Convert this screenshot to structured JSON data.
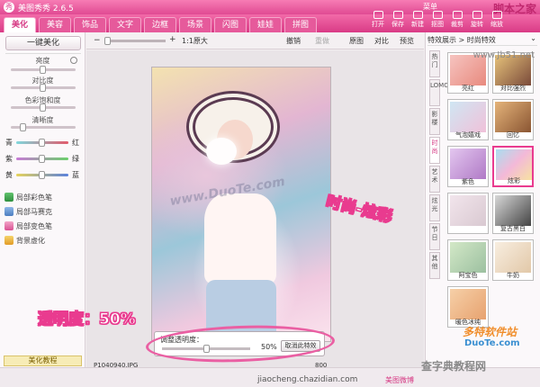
{
  "window": {
    "title": "美图秀秀 2.6.5",
    "logo": "秀"
  },
  "watermark_top": "脚本之家",
  "watermark_url": "www.Jb51.net",
  "tabs": [
    "美化",
    "美容",
    "饰品",
    "文字",
    "边框",
    "场景",
    "闪图",
    "娃娃",
    "拼图"
  ],
  "toolbar": [
    "打开",
    "保存",
    "新建",
    "抠图",
    "裁剪",
    "旋转",
    "缩放"
  ],
  "help_link": "菜单",
  "left": {
    "onekey": "一键美化",
    "sliders": [
      "亮度",
      "对比度",
      "色彩饱和度",
      "清晰度"
    ],
    "color_pairs": [
      [
        "青",
        "红"
      ],
      [
        "紫",
        "绿"
      ],
      [
        "黄",
        "蓝"
      ]
    ],
    "options": [
      "局部彩色笔",
      "局部马赛克",
      "局部变色笔",
      "背景虚化"
    ],
    "tutorial": "美化教程"
  },
  "centerbar": {
    "zoom_label": "1:1原大",
    "undo": "撤销",
    "redo": "重做",
    "compare1": "原图",
    "compare2": "对比",
    "compare3": "预览"
  },
  "photo_watermark": "www.DuoTe.com",
  "dialog": {
    "label": "调整透明度：",
    "value": "50%",
    "cancel": "取消此特效"
  },
  "annotations": {
    "opacity": "透明度：50%",
    "effect": "时尚-炫彩"
  },
  "filename": "P1040940.JPG",
  "size_text": "800",
  "right": {
    "header": "特效展示 > 时尚特效",
    "vtabs": [
      "热门",
      "LOMO",
      "影楼",
      "时尚",
      "艺术",
      "炫光",
      "节日",
      "其他"
    ],
    "effects": [
      "亮红",
      "对比强烈",
      "气泡嬉戏",
      "回忆",
      "紫色",
      "炫彩",
      "",
      "复古黑白",
      "阿宝色",
      "牛奶",
      "暖色冰纯",
      ""
    ],
    "selected": "炫彩"
  },
  "duote": {
    "logo": "多特软件站",
    "url": "DuoTe.com"
  },
  "site_stamp": "查字典教程网",
  "status": {
    "url": "jiaocheng.chazidian.com",
    "left": "美图微博"
  },
  "colors": {
    "accent": "#e04a93",
    "tab_bar": "#d93b86"
  }
}
